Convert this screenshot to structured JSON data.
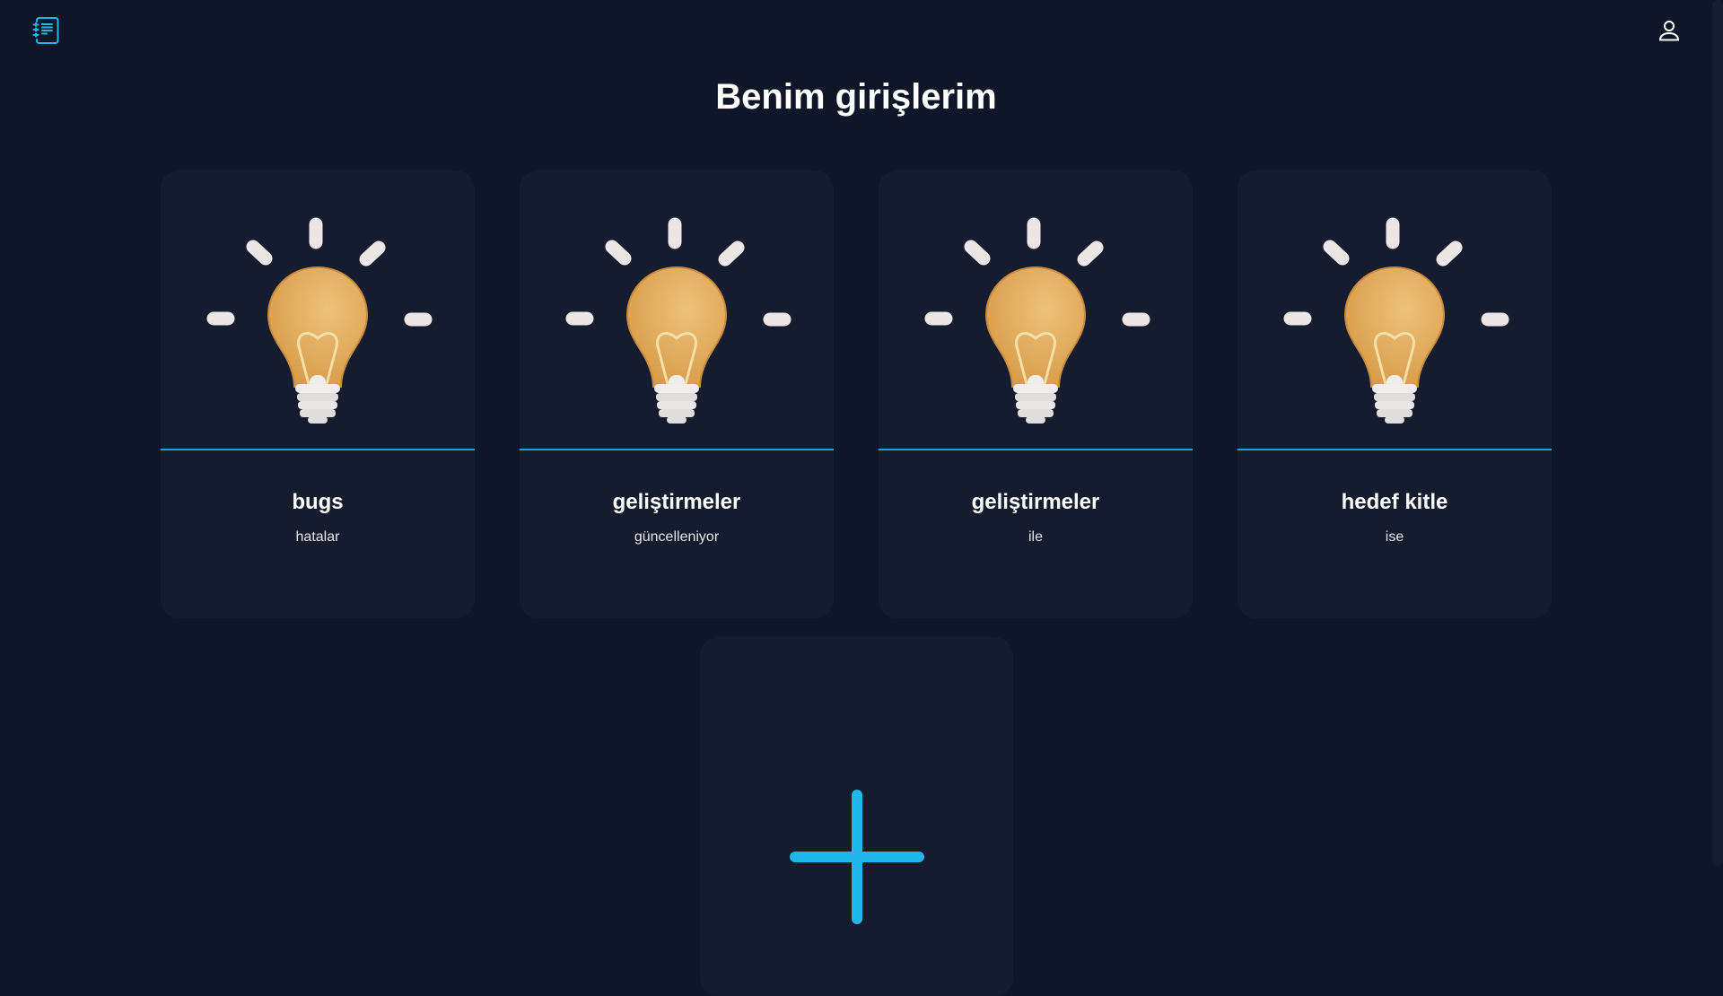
{
  "header": {
    "logo_icon": "notebook-list-icon",
    "user_icon": "user-icon",
    "accent": "#1fb6e8"
  },
  "page_title": "Benim girişlerim",
  "cards": [
    {
      "title": "bugs",
      "subtitle": "hatalar",
      "icon": "lightbulb-icon"
    },
    {
      "title": "geliştirmeler",
      "subtitle": "güncelleniyor",
      "icon": "lightbulb-icon"
    },
    {
      "title": "geliştirmeler",
      "subtitle": "ile",
      "icon": "lightbulb-icon"
    },
    {
      "title": "hedef kitle",
      "subtitle": "ise",
      "icon": "lightbulb-icon"
    }
  ],
  "add_card": {
    "icon": "plus-icon"
  }
}
